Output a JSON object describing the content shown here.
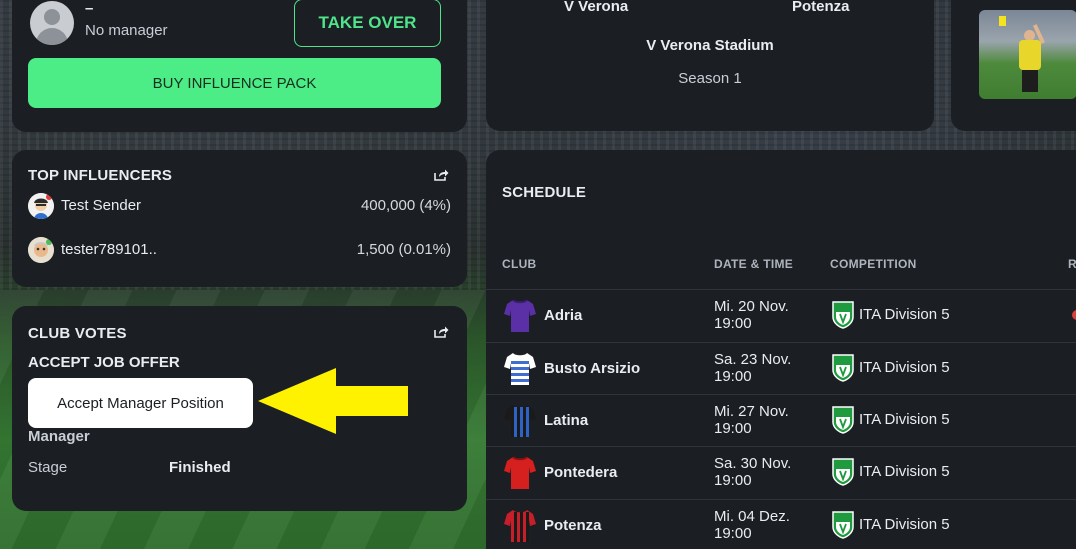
{
  "manager": {
    "name": "–",
    "status": "No manager",
    "takeover_label": "TAKE OVER",
    "influence_label": "BUY INFLUENCE PACK"
  },
  "match": {
    "home": "V Verona",
    "away": "Potenza",
    "stadium": "V Verona Stadium",
    "season": "Season 1"
  },
  "influencers": {
    "title": "TOP INFLUENCERS",
    "rows": [
      {
        "name": "Test Sender",
        "value": "400,000 (4%)"
      },
      {
        "name": "tester789101..",
        "value": "1,500 (0.01%)"
      }
    ]
  },
  "votes": {
    "title": "CLUB VOTES",
    "subtitle": "ACCEPT JOB OFFER",
    "accept_label": "Accept Manager Position",
    "manager_label": "Manager",
    "stage_label": "Stage",
    "stage_value": "Finished"
  },
  "schedule": {
    "title": "SCHEDULE",
    "columns": {
      "club": "CLUB",
      "datetime": "DATE & TIME",
      "competition": "COMPETITION",
      "result": "R"
    },
    "rows": [
      {
        "club": "Adria",
        "date": "Mi. 20 Nov.",
        "time": "19:00",
        "competition": "ITA Division 5"
      },
      {
        "club": "Busto Arsizio",
        "date": "Sa. 23 Nov.",
        "time": "19:00",
        "competition": "ITA Division 5"
      },
      {
        "club": "Latina",
        "date": "Mi. 27 Nov.",
        "time": "19:00",
        "competition": "ITA Division 5"
      },
      {
        "club": "Pontedera",
        "date": "Sa. 30 Nov.",
        "time": "19:00",
        "competition": "ITA Division 5"
      },
      {
        "club": "Potenza",
        "date": "Mi. 04 Dez.",
        "time": "19:00",
        "competition": "ITA Division 5"
      }
    ]
  },
  "colors": {
    "accent_green": "#4cec87",
    "card_bg": "#1b1e23",
    "arrow_yellow": "#fff200"
  },
  "icons": [
    "avatar-icon",
    "share-icon",
    "jersey-icon",
    "league-shield-icon",
    "arrow-pointer"
  ]
}
